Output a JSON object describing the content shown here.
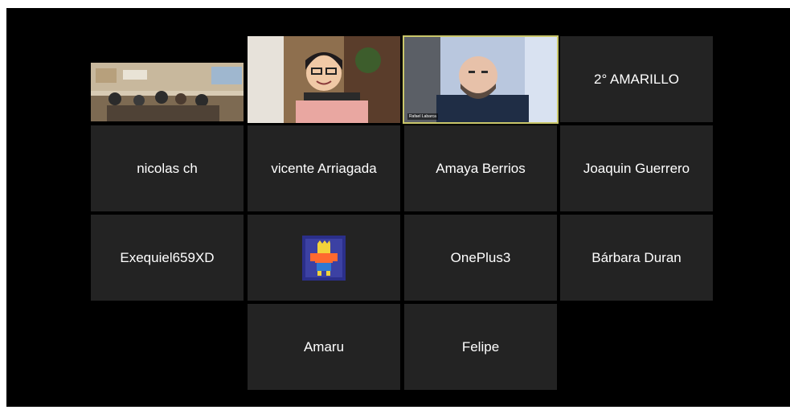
{
  "participants": {
    "p1": {
      "name": "",
      "type": "video",
      "video": "classroom-video"
    },
    "p2": {
      "name": "",
      "type": "video",
      "video": "teacher-video"
    },
    "p3": {
      "name": "",
      "type": "video",
      "video": "speaker-video",
      "label": "Rafael Labarca",
      "speaking": true
    },
    "p4": {
      "name": "2° AMARILLO",
      "type": "name"
    },
    "p5": {
      "name": "nicolas ch",
      "type": "name"
    },
    "p6": {
      "name": "vicente Arriagada",
      "type": "name"
    },
    "p7": {
      "name": "Amaya Berrios",
      "type": "name"
    },
    "p8": {
      "name": "Joaquin Guerrero",
      "type": "name"
    },
    "p9": {
      "name": "Exequiel659XD",
      "type": "name"
    },
    "p10": {
      "name": "",
      "type": "avatar",
      "avatar": "cartoon-avatar-image"
    },
    "p11": {
      "name": "OnePlus3",
      "type": "name"
    },
    "p12": {
      "name": "Bárbara Duran",
      "type": "name"
    },
    "p13": {
      "name": "Amaru",
      "type": "name"
    },
    "p14": {
      "name": "Felipe",
      "type": "name"
    }
  },
  "colors": {
    "background": "#000000",
    "tile": "#232323",
    "speaking_border": "#c9c66a",
    "text": "#ffffff"
  }
}
